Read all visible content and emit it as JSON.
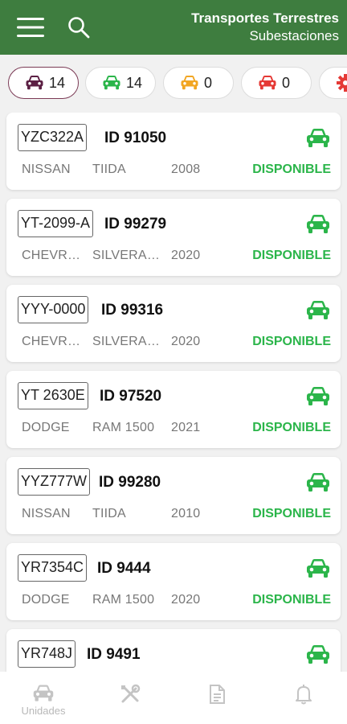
{
  "header": {
    "title": "Transportes Terrestres",
    "subtitle": "Subestaciones"
  },
  "filters": [
    {
      "count": "14",
      "color": "#5c2044",
      "active": true,
      "icon": "car-icon"
    },
    {
      "count": "14",
      "color": "#2bb54a",
      "active": false,
      "icon": "car-icon"
    },
    {
      "count": "0",
      "color": "#f2a623",
      "active": false,
      "icon": "car-icon"
    },
    {
      "count": "0",
      "color": "#e53935",
      "active": false,
      "icon": "car-icon"
    },
    {
      "count": "",
      "color": "#e53935",
      "active": false,
      "icon": "gear-icon"
    }
  ],
  "vehicles": [
    {
      "plate": "YZC322A",
      "id": "ID 91050",
      "brand": "NISSAN",
      "model": "TIIDA",
      "year": "2008",
      "status": "DISPONIBLE"
    },
    {
      "plate": "YT-2099-A",
      "id": "ID 99279",
      "brand": "CHEVROLET",
      "model": "SILVERADO",
      "year": "2020",
      "status": "DISPONIBLE"
    },
    {
      "plate": "YYY-0000",
      "id": "ID 99316",
      "brand": "CHEVROLET",
      "model": "SILVERADO",
      "year": "2020",
      "status": "DISPONIBLE"
    },
    {
      "plate": "YT 2630E",
      "id": "ID 97520",
      "brand": "DODGE",
      "model": "RAM 1500",
      "year": "2021",
      "status": "DISPONIBLE"
    },
    {
      "plate": "YYZ777W",
      "id": "ID 99280",
      "brand": "NISSAN",
      "model": "TIIDA",
      "year": "2010",
      "status": "DISPONIBLE"
    },
    {
      "plate": "YR7354C",
      "id": "ID 9444",
      "brand": "DODGE",
      "model": "RAM 1500",
      "year": "2020",
      "status": "DISPONIBLE"
    },
    {
      "plate": "YR748J",
      "id": "ID 9491",
      "brand": "",
      "model": "",
      "year": "",
      "status": ""
    }
  ],
  "bottom_nav": [
    {
      "label": "Unidades",
      "icon": "car-icon"
    },
    {
      "label": "",
      "icon": "tools-icon"
    },
    {
      "label": "",
      "icon": "document-icon"
    },
    {
      "label": "",
      "icon": "bell-icon"
    }
  ],
  "colors": {
    "primary": "#3e7d3f",
    "available": "#2bb54a",
    "active_border": "#7b3a55",
    "inactive_nav": "#c4c4c4"
  }
}
